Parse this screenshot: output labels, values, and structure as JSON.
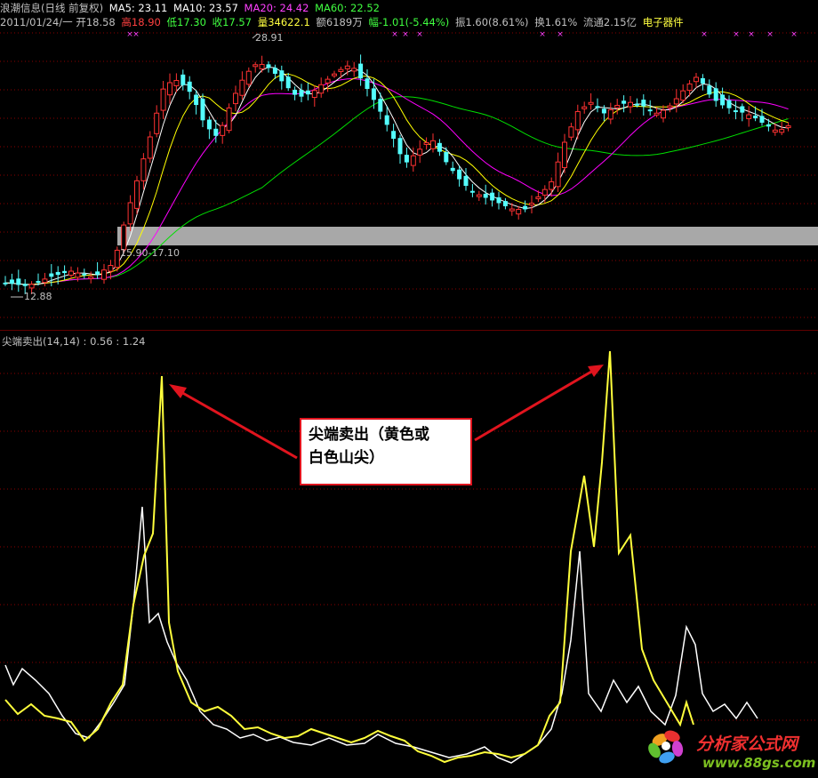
{
  "header": {
    "title": "浪潮信息(日线 前复权)",
    "ma5": "MA5: 23.11",
    "ma10": "MA10: 23.57",
    "ma20": "MA20: 24.42",
    "ma60": "MA60: 22.52",
    "date": "2011/01/24/一",
    "open": "开18.58",
    "high": "高18.90",
    "low": "低17.30",
    "close": "收17.57",
    "volume": "量34622.1",
    "amount": "额6189万",
    "change": "幅-1.01(-5.44%)",
    "amplitude": "振1.60(8.61%)",
    "turnover": "换1.61%",
    "float_cap": "流通2.15亿",
    "sector": "电子器件"
  },
  "colors": {
    "up": "#ff3232",
    "down": "#54ffff",
    "ma5": "#ffffff",
    "ma10": "#ffff00",
    "ma20": "#ff00ff",
    "ma60": "#00e000",
    "grid": "#8b0000",
    "indicator_yellow": "#ffff3c",
    "indicator_white": "#ffffff"
  },
  "price_labels": {
    "high_mark": "28.91",
    "low_mark": "12.88",
    "band": "15.90-17.10"
  },
  "indicator": {
    "title": "尖端卖出(14,14) : 0.56 : 1.24"
  },
  "callout": {
    "line1": "尖端卖出（黄色或",
    "line2": "白色山尖）"
  },
  "watermark": {
    "text": "分析家公式网",
    "url": "www.88gs.com"
  }
}
